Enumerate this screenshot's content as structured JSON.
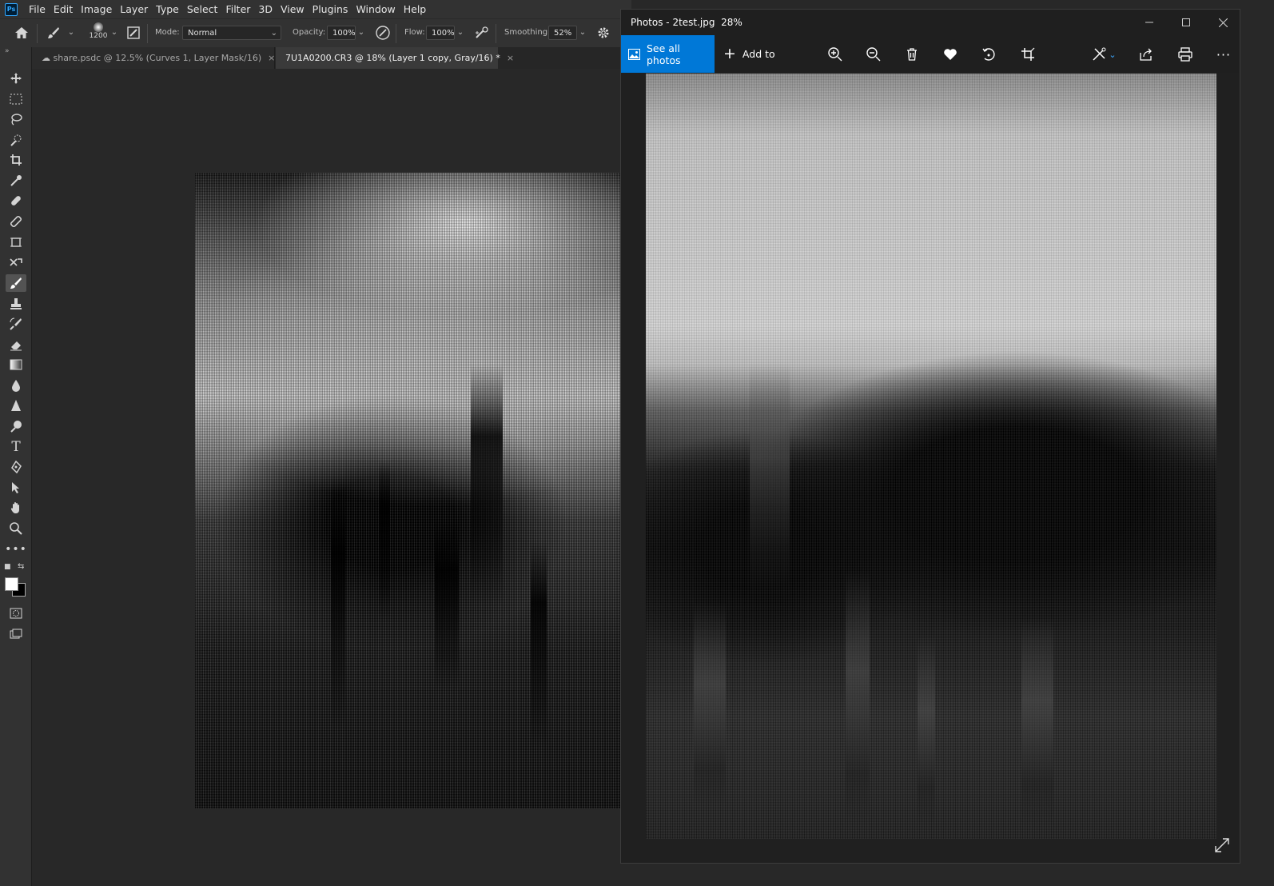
{
  "photoshop": {
    "logo": "Ps",
    "menu": [
      "File",
      "Edit",
      "Image",
      "Layer",
      "Type",
      "Select",
      "Filter",
      "3D",
      "View",
      "Plugins",
      "Window",
      "Help"
    ],
    "options": {
      "brush_size": "1200",
      "mode_label": "Mode:",
      "mode_value": "Normal",
      "opacity_label": "Opacity:",
      "opacity_value": "100%",
      "flow_label": "Flow:",
      "flow_value": "100%",
      "smoothing_label": "Smoothing:",
      "smoothing_value": "52%"
    },
    "tabs": [
      {
        "label": "share.psdc @ 12.5% (Curves 1, Layer Mask/16)",
        "active": false
      },
      {
        "label": "7U1A0200.CR3 @ 18% (Layer 1 copy, Gray/16) *",
        "active": true
      }
    ],
    "tools": [
      "move-tool-icon",
      "marquee-tool-icon",
      "lasso-tool-icon",
      "quick-select-tool-icon",
      "crop-tool-icon",
      "eyedropper-tool-icon",
      "healing-tool-icon",
      "patch-tool-icon",
      "frame-tool-icon",
      "content-aware-move-tool-icon",
      "brush-tool-icon",
      "stamp-tool-icon",
      "history-brush-tool-icon",
      "eraser-tool-icon",
      "gradient-tool-icon",
      "blur-tool-icon",
      "sharpen-tool-icon",
      "dodge-tool-icon",
      "type-tool-icon",
      "pen-tool-icon",
      "path-select-tool-icon",
      "hand-tool-icon",
      "zoom-tool-icon",
      "more-tools-icon"
    ]
  },
  "photos": {
    "title": "Photos - 2test.jpg",
    "zoom": "28%",
    "see_all": "See all photos",
    "add_to": "Add to",
    "toolbar_icons": [
      "zoom-in-icon",
      "zoom-out-icon",
      "delete-icon",
      "favorite-icon",
      "rotate-icon",
      "crop-icon",
      "edit-icon",
      "share-icon",
      "print-icon",
      "more-icon"
    ]
  },
  "colors": {
    "accent": "#0078d7",
    "ps_panel": "#323232",
    "ps_canvas": "#282828"
  }
}
